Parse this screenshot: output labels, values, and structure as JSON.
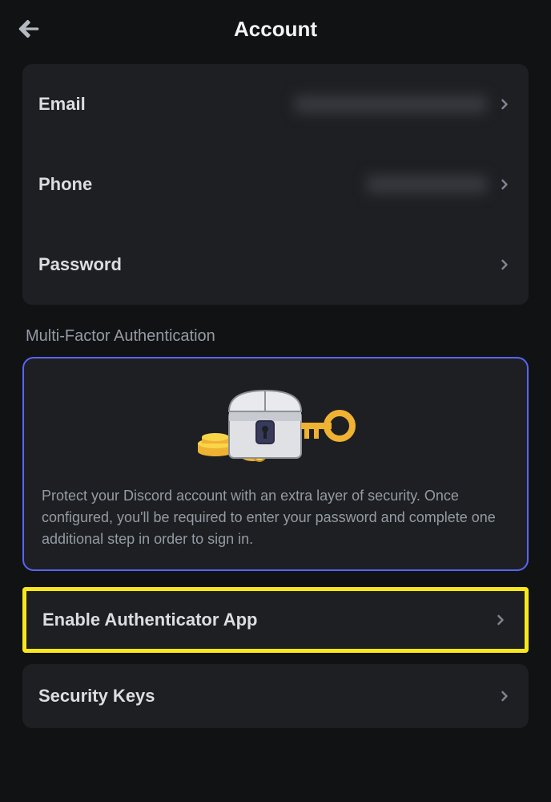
{
  "header": {
    "title": "Account"
  },
  "accountInfo": {
    "rows": [
      {
        "label": "Email"
      },
      {
        "label": "Phone"
      },
      {
        "label": "Password"
      }
    ]
  },
  "mfa": {
    "sectionHeader": "Multi-Factor Authentication",
    "description": "Protect your Discord account with an extra layer of security. Once configured, you'll be required to enter your password and complete one additional step in order to sign in."
  },
  "actions": {
    "enableAuthenticator": "Enable Authenticator App",
    "securityKeys": "Security Keys"
  }
}
